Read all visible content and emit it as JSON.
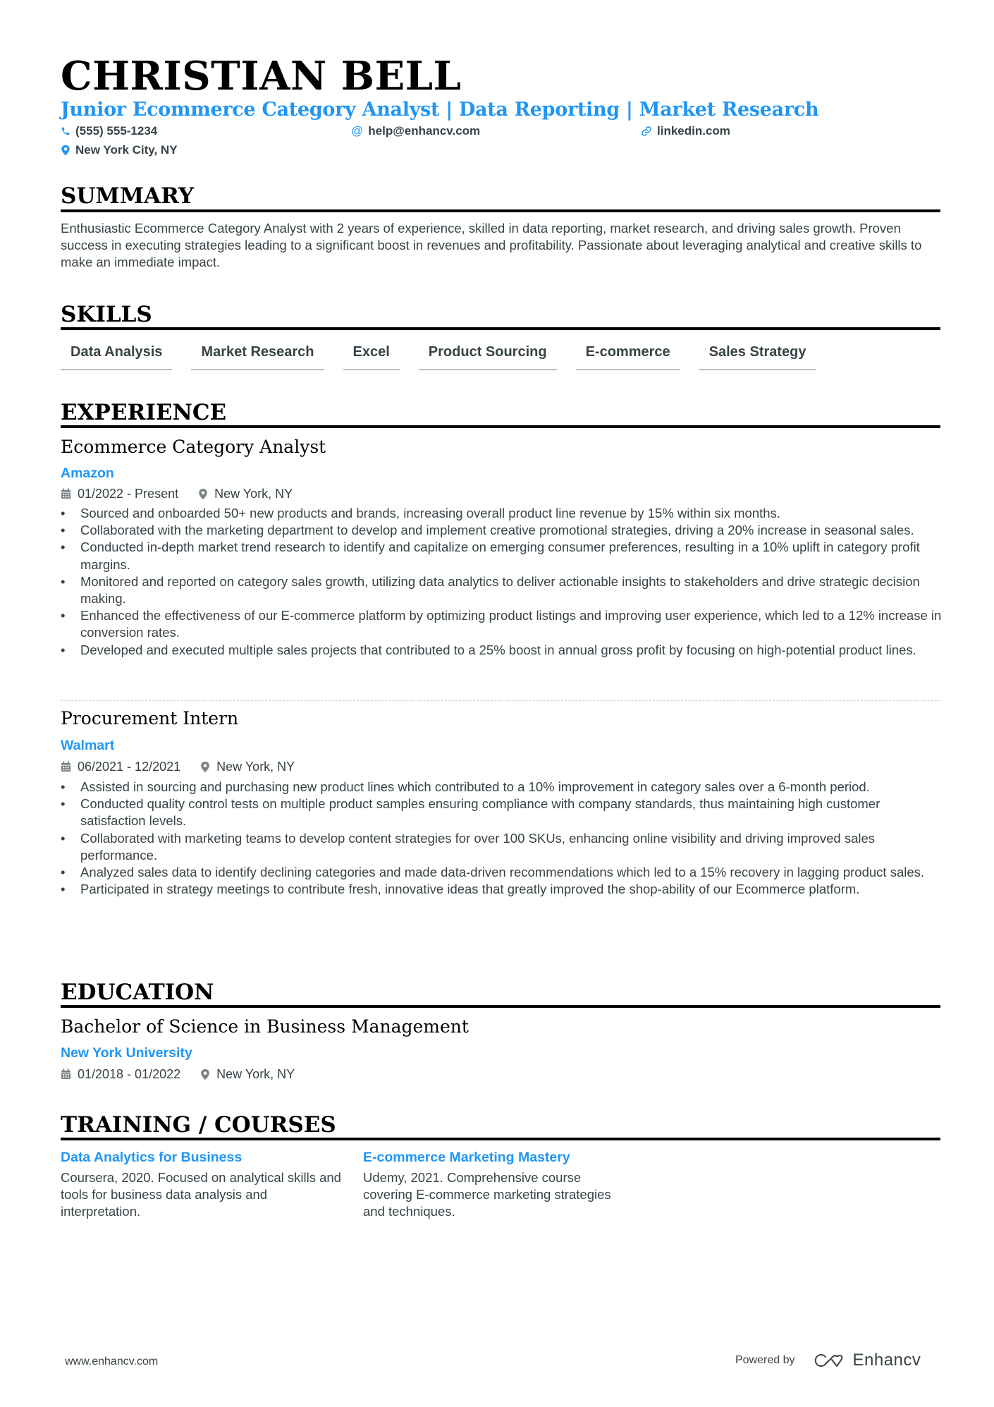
{
  "header": {
    "name": "CHRISTIAN BELL",
    "headline": "Junior Ecommerce Category Analyst | Data Reporting | Market Research",
    "contacts": {
      "phone": {
        "icon": "phone-icon",
        "value": "(555) 555-1234"
      },
      "email": {
        "icon": "at-icon",
        "value": "help@enhancv.com"
      },
      "website": {
        "icon": "link-icon",
        "value": "linkedin.com"
      },
      "location": {
        "icon": "location-pin-icon",
        "value": "New York City, NY"
      }
    }
  },
  "colors": {
    "accent": "#2196f3",
    "text": "#384347",
    "heading": "#000000"
  },
  "summary": {
    "title": "SUMMARY",
    "text": "Enthusiastic Ecommerce Category Analyst with 2 years of experience, skilled in data reporting, market research, and driving sales growth. Proven success in executing strategies leading to a significant boost in revenues and profitability. Passionate about leveraging analytical and creative skills to make an immediate impact."
  },
  "skills": {
    "title": "SKILLS",
    "items": [
      "Data Analysis",
      "Market Research",
      "Excel",
      "Product Sourcing",
      "E-commerce",
      "Sales Strategy"
    ]
  },
  "experience": {
    "title": "EXPERIENCE",
    "jobs": [
      {
        "role": "Ecommerce Category Analyst",
        "company": "Amazon",
        "dates": "01/2022 - Present",
        "location": "New York, NY",
        "bullets": [
          "Sourced and onboarded 50+ new products and brands, increasing overall product line revenue by 15% within six months.",
          "Collaborated with the marketing department to develop and implement creative promotional strategies, driving a 20% increase in seasonal sales.",
          "Conducted in-depth market trend research to identify and capitalize on emerging consumer preferences, resulting in a 10% uplift in category profit margins.",
          "Monitored and reported on category sales growth, utilizing data analytics to deliver actionable insights to stakeholders and drive strategic decision making.",
          "Enhanced the effectiveness of our E-commerce platform by optimizing product listings and improving user experience, which led to a 12% increase in conversion rates.",
          "Developed and executed multiple sales projects that contributed to a 25% boost in annual gross profit by focusing on high-potential product lines."
        ]
      },
      {
        "role": "Procurement Intern",
        "company": "Walmart",
        "dates": "06/2021 - 12/2021",
        "location": "New York, NY",
        "bullets": [
          "Assisted in sourcing and purchasing new product lines which contributed to a 10% improvement in category sales over a 6-month period.",
          "Conducted quality control tests on multiple product samples ensuring compliance with company standards, thus maintaining high customer satisfaction levels.",
          "Collaborated with marketing teams to develop content strategies for over 100 SKUs, enhancing online visibility and driving improved sales performance.",
          "Analyzed sales data to identify declining categories and made data-driven recommendations which led to a 15% recovery in lagging product sales.",
          "Participated in strategy meetings to contribute fresh, innovative ideas that greatly improved the shop-ability of our Ecommerce platform."
        ]
      }
    ]
  },
  "education": {
    "title": "EDUCATION",
    "degree": "Bachelor of Science in Business Management",
    "school": "New York University",
    "dates": "01/2018 - 01/2022",
    "location": "New York, NY"
  },
  "training": {
    "title": "TRAINING / COURSES",
    "courses": [
      {
        "title": "Data Analytics for Business",
        "description": "Coursera, 2020. Focused on analytical skills and tools for business data analysis and interpretation."
      },
      {
        "title": "E-commerce Marketing Mastery",
        "description": "Udemy, 2021. Comprehensive course covering E-commerce marketing strategies and techniques."
      }
    ]
  },
  "footer": {
    "url": "www.enhancv.com",
    "powered_by": "Powered by",
    "brand": "Enhancv",
    "brand_icon": "enhancv-logo-icon"
  }
}
